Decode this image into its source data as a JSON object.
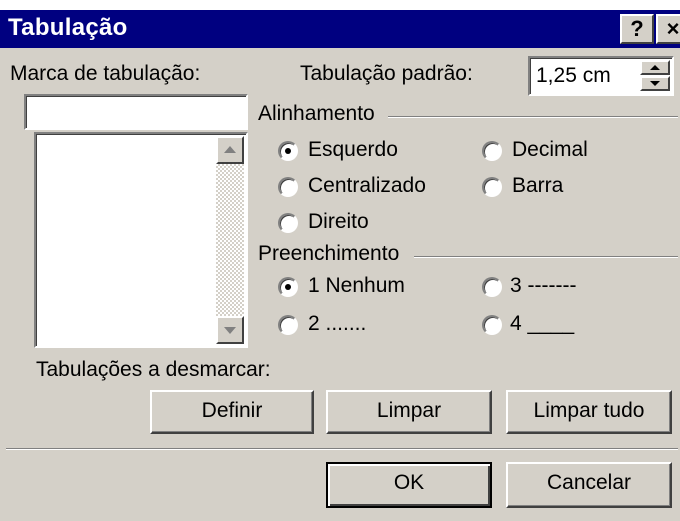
{
  "titlebar": {
    "title": "Tabulação",
    "help_glyph": "?",
    "close_glyph": "×"
  },
  "tab_stop": {
    "label": "Marca de tabulação:",
    "value": "",
    "list_items": []
  },
  "default_tab": {
    "label": "Tabulação padrão:",
    "value": "1,25 cm"
  },
  "alignment": {
    "heading": "Alinhamento",
    "options": [
      {
        "label": "Esquerdo",
        "checked": true
      },
      {
        "label": "Centralizado",
        "checked": false
      },
      {
        "label": "Direito",
        "checked": false
      },
      {
        "label": "Decimal",
        "checked": false
      },
      {
        "label": "Barra",
        "checked": false
      }
    ]
  },
  "leader": {
    "heading": "Preenchimento",
    "options": [
      {
        "label": "1 Nenhum",
        "checked": true
      },
      {
        "label": "2 .......",
        "checked": false
      },
      {
        "label": "3 -------",
        "checked": false
      },
      {
        "label": "4 ____",
        "checked": false
      }
    ]
  },
  "clear_label": "Tabulações a desmarcar:",
  "buttons": {
    "set": "Definir",
    "clear": "Limpar",
    "clear_all": "Limpar tudo",
    "ok": "OK",
    "cancel": "Cancelar"
  }
}
